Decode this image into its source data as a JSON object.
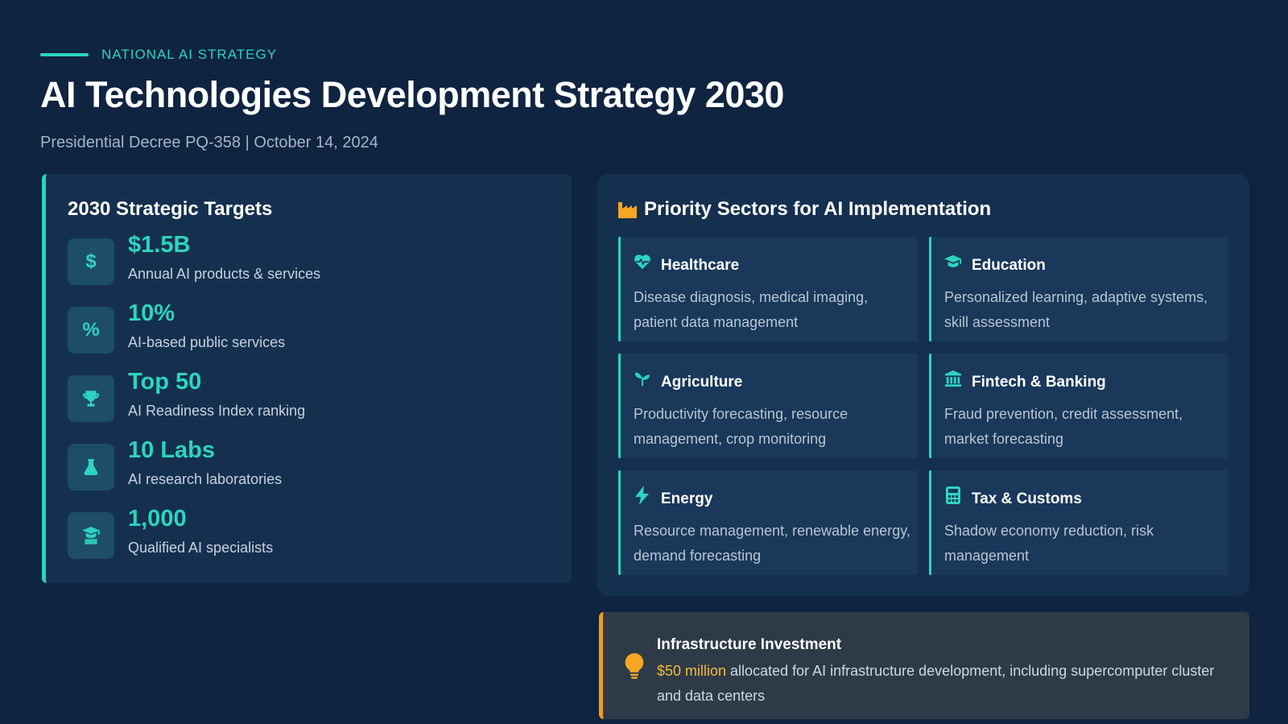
{
  "header": {
    "eyebrow": "NATIONAL AI STRATEGY",
    "title": "AI Technologies Development Strategy 2030",
    "subtitle": "Presidential Decree PQ-358 | October 14, 2024"
  },
  "targets": {
    "heading": "2030 Strategic Targets",
    "items": [
      {
        "icon": "dollar-icon",
        "value": "$1.5B",
        "label": "Annual AI products & services"
      },
      {
        "icon": "percent-icon",
        "value": "10%",
        "label": "AI-based public services"
      },
      {
        "icon": "trophy-icon",
        "value": "Top 50",
        "label": "AI Readiness Index ranking"
      },
      {
        "icon": "flask-icon",
        "value": "10 Labs",
        "label": "AI research laboratories"
      },
      {
        "icon": "graduate-icon",
        "value": "1,000",
        "label": "Qualified AI specialists"
      }
    ]
  },
  "sectors": {
    "heading": "Priority Sectors for AI Implementation",
    "items": [
      {
        "icon": "heart-pulse-icon",
        "name": "Healthcare",
        "desc": "Disease diagnosis, medical imaging, patient data management"
      },
      {
        "icon": "graduation-cap-icon",
        "name": "Education",
        "desc": "Personalized learning, adaptive systems, skill assessment"
      },
      {
        "icon": "seedling-icon",
        "name": "Agriculture",
        "desc": "Productivity forecasting, resource management, crop monitoring"
      },
      {
        "icon": "bank-icon",
        "name": "Fintech & Banking",
        "desc": "Fraud prevention, credit assessment, market forecasting"
      },
      {
        "icon": "bolt-icon",
        "name": "Energy",
        "desc": "Resource management, renewable energy, demand forecasting"
      },
      {
        "icon": "calculator-icon",
        "name": "Tax & Customs",
        "desc": "Shadow economy reduction, risk management"
      }
    ]
  },
  "infrastructure": {
    "heading": "Infrastructure Investment",
    "amount": "$50 million",
    "text": " allocated for AI infrastructure development, including supercomputer cluster and data centers"
  },
  "colors": {
    "background": "#0f2440",
    "card": "#15304f",
    "accent": "#2dd4bf",
    "highlight": "#f59e0b"
  }
}
